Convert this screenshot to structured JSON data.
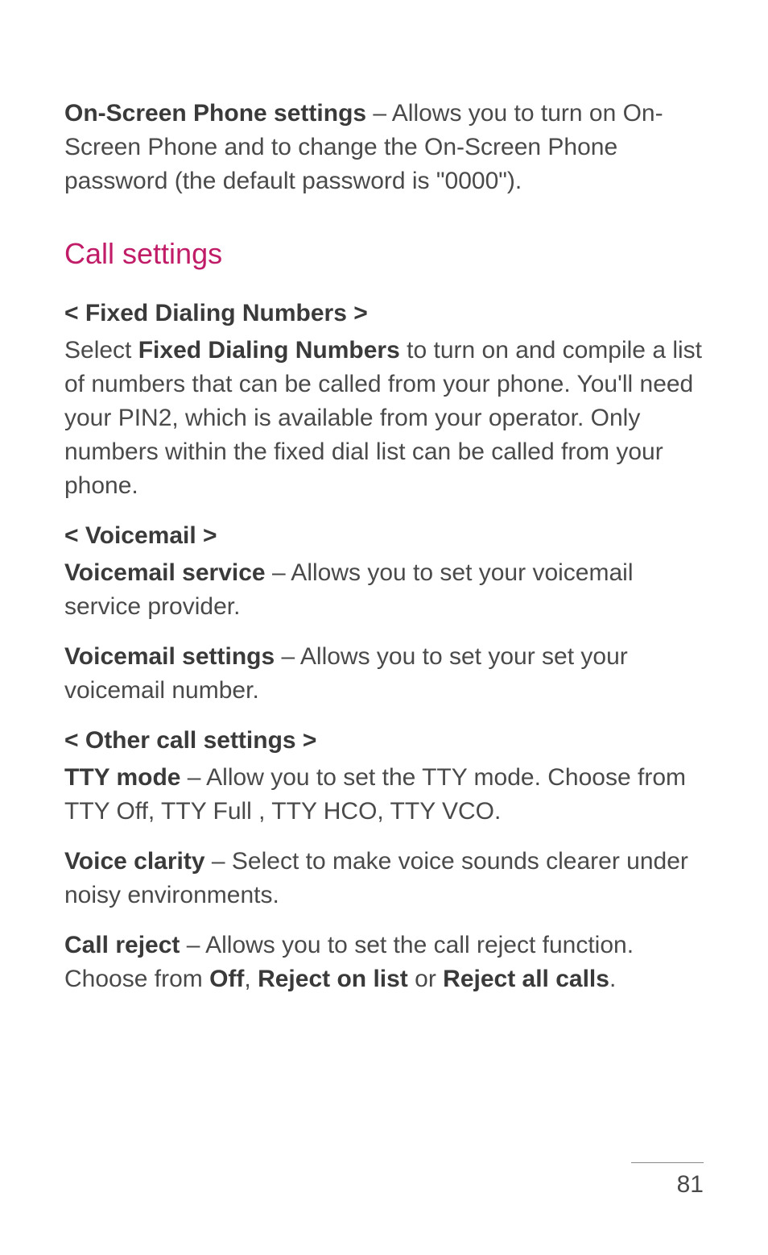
{
  "intro": {
    "bold": "On-Screen Phone settings",
    "rest": " – Allows you to turn on On-Screen Phone and to change the On-Screen Phone password (the default password is \"0000\")."
  },
  "section_title": "Call settings",
  "fdn": {
    "heading": "< Fixed Dialing Numbers >",
    "pre": "Select ",
    "bold": "Fixed Dialing Numbers",
    "post": " to turn on and compile a list of numbers that can be called from your phone. You'll need your PIN2, which is available from your operator. Only numbers within the fixed dial list can be called from your phone."
  },
  "voicemail": {
    "heading": "< Voicemail >",
    "service": {
      "bold": "Voicemail service",
      "rest": " – Allows you to set your voicemail service provider."
    },
    "settings": {
      "bold": "Voicemail settings",
      "rest": " – Allows you to set your set your voicemail number."
    }
  },
  "other": {
    "heading": "< Other call settings >",
    "tty": {
      "bold": "TTY mode",
      "rest": " – Allow you to set the TTY mode. Choose from TTY Off, TTY Full , TTY HCO, TTY VCO."
    },
    "clarity": {
      "bold": "Voice clarity",
      "rest": " – Select to make voice sounds clearer under noisy environments."
    },
    "reject": {
      "bold": "Call reject",
      "t1": " – Allows you to set the call reject function. Choose from ",
      "opt1": "Off",
      "sep1": ", ",
      "opt2": "Reject on list",
      "sep2": " or ",
      "opt3": "Reject all calls",
      "end": "."
    }
  },
  "page_number": "81"
}
